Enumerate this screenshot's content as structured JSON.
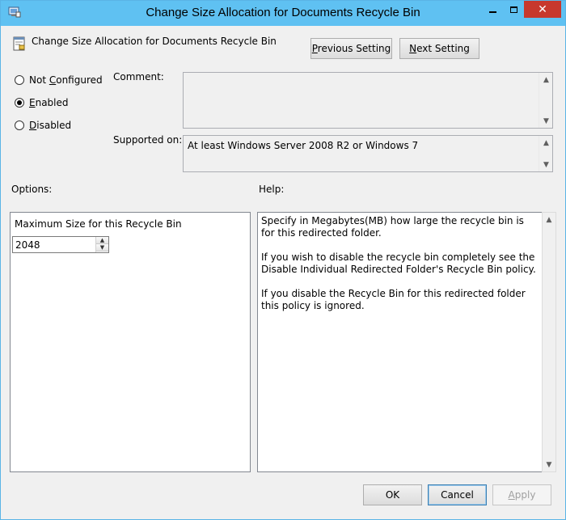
{
  "window": {
    "title": "Change Size Allocation for Documents Recycle Bin",
    "minimize_icon": "minimize-icon",
    "maximize_icon": "maximize-icon",
    "close_icon": "close-icon"
  },
  "header": {
    "policy_name": "Change Size Allocation for Documents Recycle Bin",
    "previous_label_pre": "",
    "previous_label_ul": "P",
    "previous_label_post": "revious Setting",
    "next_label_pre": "",
    "next_label_ul": "N",
    "next_label_post": "ext Setting"
  },
  "state": {
    "options": [
      {
        "label_pre": "Not ",
        "label_ul": "C",
        "label_post": "onfigured",
        "checked": false
      },
      {
        "label_pre": "",
        "label_ul": "E",
        "label_post": "nabled",
        "checked": true
      },
      {
        "label_pre": "",
        "label_ul": "D",
        "label_post": "isabled",
        "checked": false
      }
    ]
  },
  "comment": {
    "label": "Comment:",
    "value": ""
  },
  "supported": {
    "label": "Supported on:",
    "value": "At least Windows Server 2008 R2 or Windows 7"
  },
  "options_section": {
    "label": "Options:",
    "field_label": "Maximum Size for this Recycle Bin",
    "field_value": "2048"
  },
  "help_section": {
    "label": "Help:",
    "paragraphs": [
      "Specify in Megabytes(MB) how large the recycle bin is for this redirected folder.",
      "If you wish to disable the recycle bin completely see the Disable Individual Redirected Folder's Recycle Bin policy.",
      "If you disable the Recycle Bin for this redirected folder this policy is ignored."
    ]
  },
  "footer": {
    "ok_label": "OK",
    "cancel_label": "Cancel",
    "apply_label": "Apply"
  }
}
